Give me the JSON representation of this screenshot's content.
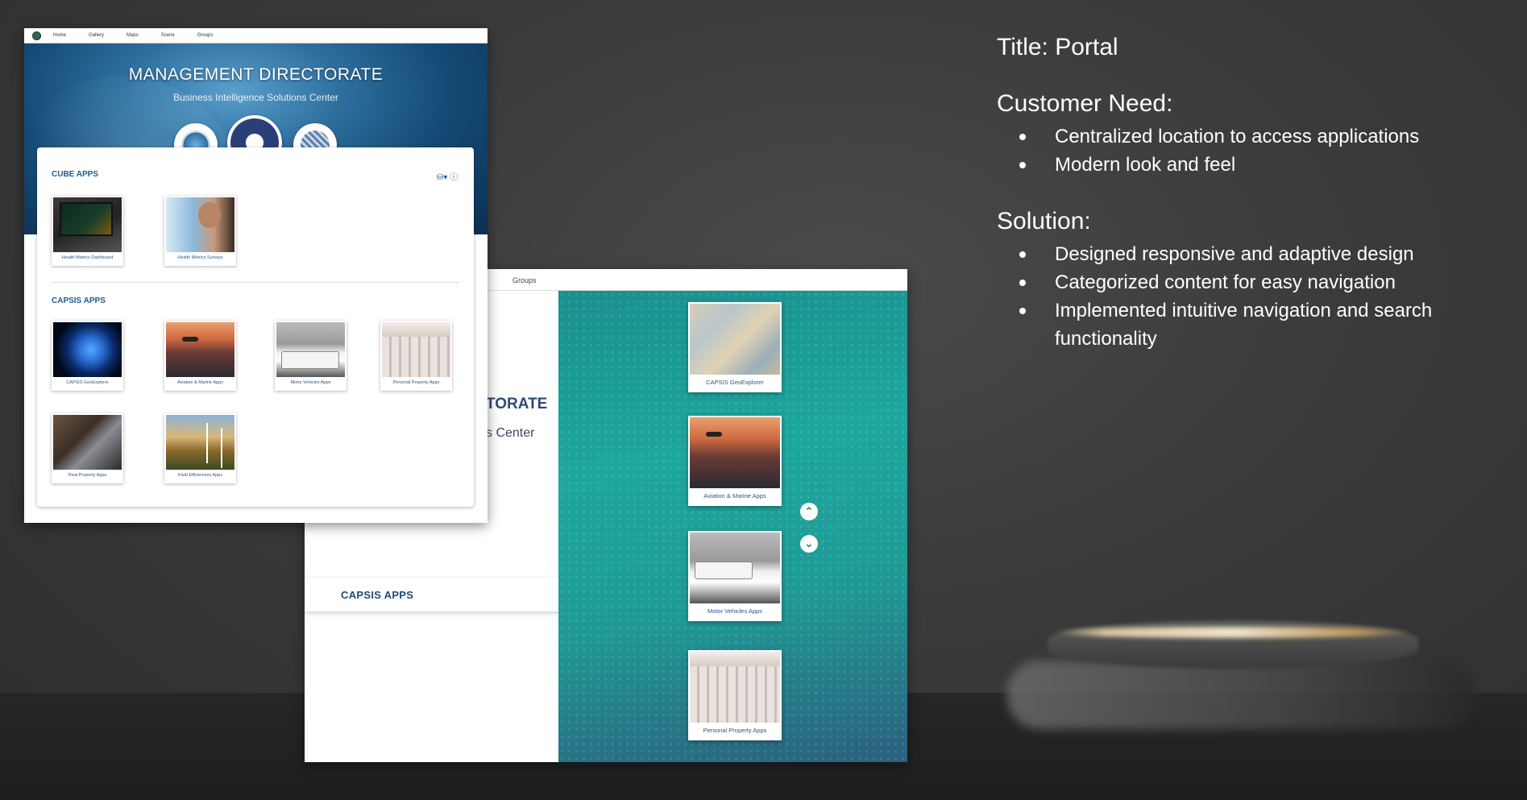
{
  "info": {
    "title": "Title: Portal",
    "need_heading": "Customer Need:",
    "needs": [
      "Centralized location to access applications",
      "Modern look and feel"
    ],
    "solution_heading": "Solution:",
    "solutions": [
      "Designed responsive and adaptive design",
      "Categorized content for easy navigation",
      "Implemented intuitive navigation and search functionality"
    ]
  },
  "front": {
    "nav": [
      "Home",
      "Gallery",
      "Maps",
      "Scene",
      "Groups"
    ],
    "title": "MANAGEMENT DIRECTORATE",
    "subtitle": "Business Intelligence Solutions Center",
    "cube_title": "CUBE APPS",
    "tools": "⛁▾  ⓘ",
    "cube_apps": [
      "Health Metrics Dashboard",
      "Health Metrics Surveys"
    ],
    "capsis_title": "CAPSIS APPS",
    "capsis_apps": [
      "CAPSIS GeoExplorer",
      "Aviation & Marine Apps",
      "Motor Vehicles Apps",
      "Personal Property Apps",
      "Real Property Apps",
      "Field Efficiencies Apps"
    ]
  },
  "back": {
    "nav_item": "Groups",
    "title_fragment": "TORATE",
    "subtitle_fragment": "s Center",
    "capsis_label": "CAPSIS APPS",
    "cards": [
      "CAPSIS GeoExplorer",
      "Aviation & Marine Apps",
      "Motor Vehicles Apps",
      "Personal Property Apps"
    ]
  }
}
